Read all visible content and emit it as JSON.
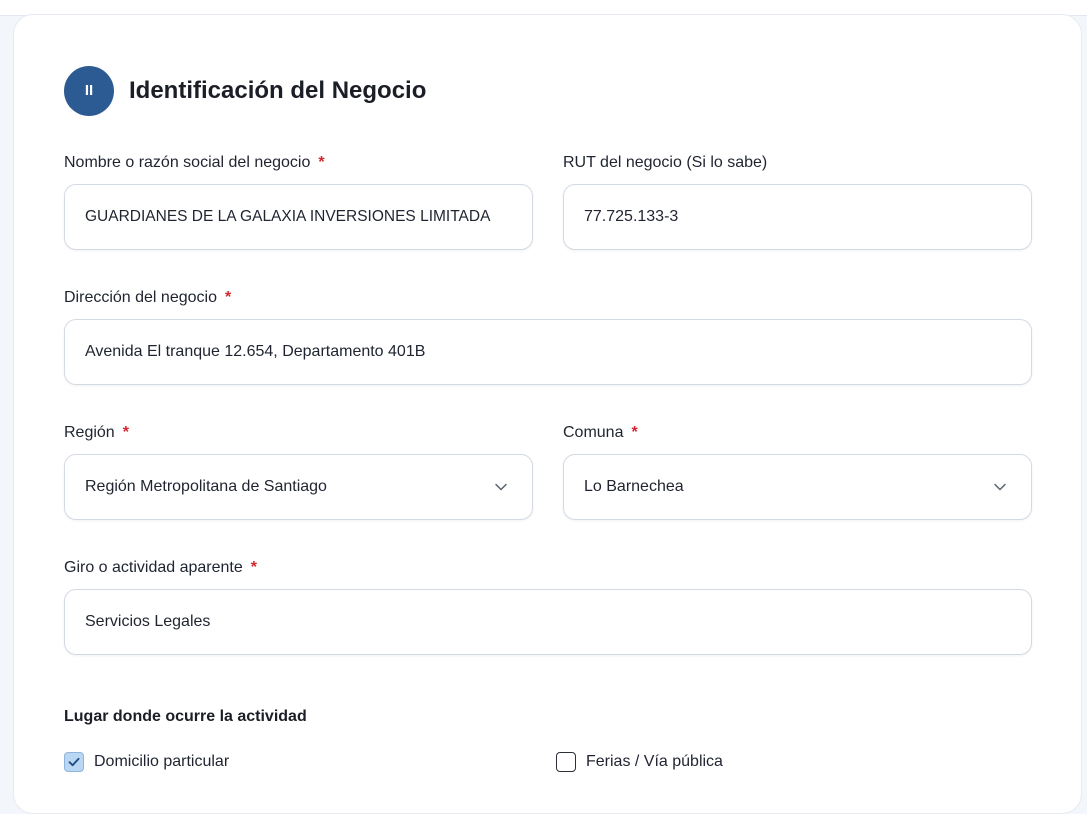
{
  "section": {
    "step_label": "II",
    "title": "Identificación del Negocio"
  },
  "required_mark": "*",
  "fields": {
    "business_name": {
      "label": "Nombre o razón social del negocio",
      "value": "GUARDIANES DE LA GALAXIA INVERSIONES LIMITADA"
    },
    "rut": {
      "label": "RUT del negocio (Si lo sabe)",
      "value": "77.725.133-3"
    },
    "address": {
      "label": "Dirección del negocio",
      "value": "Avenida El tranque 12.654, Departamento 401B"
    },
    "region": {
      "label": "Región",
      "selected": "Región Metropolitana de Santiago"
    },
    "comuna": {
      "label": "Comuna",
      "selected": "Lo Barnechea"
    },
    "activity": {
      "label": "Giro o actividad aparente",
      "value": "Servicios Legales"
    }
  },
  "location": {
    "heading": "Lugar donde ocurre la actividad",
    "options": [
      {
        "label": "Domicilio particular",
        "checked": true
      },
      {
        "label": "Ferias / Vía pública",
        "checked": false
      }
    ]
  },
  "colors": {
    "primary": "#2c5b93",
    "required": "#d3272e",
    "checkbox_checked": "#b9d6f3"
  },
  "icons": {
    "select_arrow": "chevron-down-icon",
    "check": "check-icon"
  }
}
